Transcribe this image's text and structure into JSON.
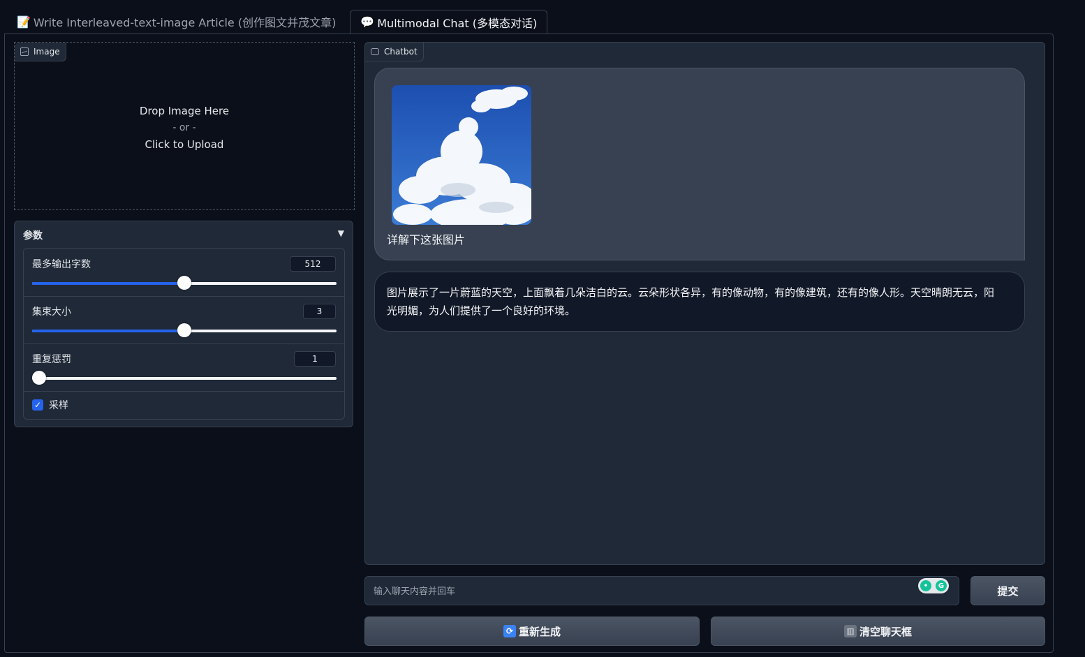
{
  "tabs": [
    {
      "label": "Write Interleaved-text-image Article (创作图文并茂文章)",
      "icon": "memo-icon",
      "active": false
    },
    {
      "label": "Multimodal Chat (多模态对话)",
      "icon": "speech-bubble-icon",
      "active": true
    }
  ],
  "image_upload": {
    "label": "Image",
    "drop_text": "Drop Image Here",
    "or_text": "- or -",
    "click_text": "Click to Upload"
  },
  "params": {
    "title": "参数",
    "max_tokens": {
      "label": "最多输出字数",
      "value": "512",
      "fraction": 0.5
    },
    "beam_size": {
      "label": "集束大小",
      "value": "3",
      "fraction": 0.5
    },
    "repetition_penalty": {
      "label": "重复惩罚",
      "value": "1",
      "fraction": 0.0
    },
    "sampling": {
      "label": "采样",
      "checked": true
    }
  },
  "chatbot": {
    "label": "Chatbot",
    "messages": [
      {
        "role": "user",
        "image": "blue-sky-clouds-photo",
        "text": "详解下这张图片"
      },
      {
        "role": "bot",
        "text": "图片展示了一片蔚蓝的天空，上面飘着几朵洁白的云。云朵形状各异，有的像动物，有的像建筑，还有的像人形。天空晴朗无云，阳光明媚，为人们提供了一个良好的环境。"
      }
    ]
  },
  "input": {
    "placeholder": "输入聊天内容并回车"
  },
  "buttons": {
    "submit": "提交",
    "regenerate": "重新生成",
    "clear": "清空聊天框"
  },
  "colors": {
    "background": "#0b0f19",
    "panel": "#1f2937",
    "accent": "#2563eb"
  }
}
